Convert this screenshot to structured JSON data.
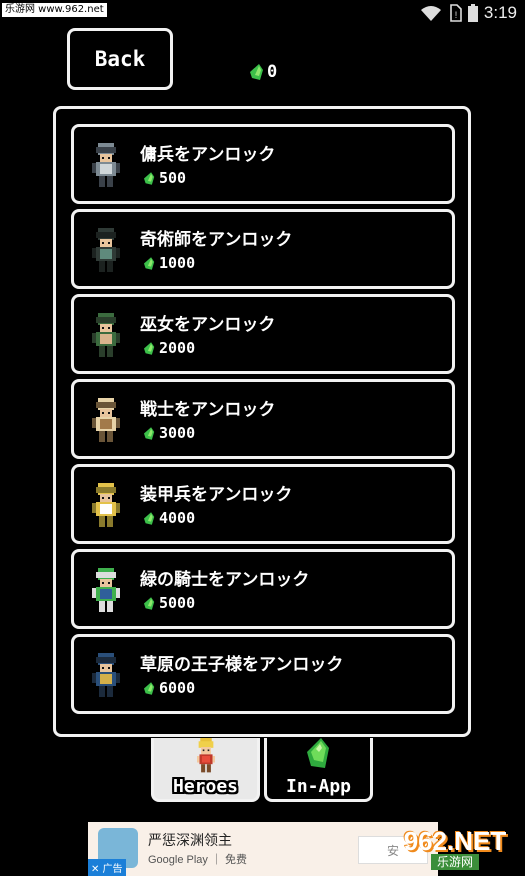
{
  "status_bar": {
    "watermark": "乐游网 www.962.net",
    "time": "3:19"
  },
  "header": {
    "back_label": "Back",
    "gem_count": "0"
  },
  "heroes": [
    {
      "name": "傭兵をアンロック",
      "cost": "500",
      "sprite": "mercenary-sprite",
      "colors": [
        "#7d8a93",
        "#cfd6d9",
        "#3a4149"
      ]
    },
    {
      "name": "奇術師をアンロック",
      "cost": "1000",
      "sprite": "magician-sprite",
      "colors": [
        "#2f3a36",
        "#5f8a7c",
        "#1c2220"
      ]
    },
    {
      "name": "巫女をアンロック",
      "cost": "2000",
      "sprite": "shrine-maiden-sprite",
      "colors": [
        "#3b6b3e",
        "#d9b48d",
        "#2a3e2b"
      ]
    },
    {
      "name": "戦士をアンロック",
      "cost": "3000",
      "sprite": "warrior-sprite",
      "colors": [
        "#e7d3a8",
        "#a27a4a",
        "#6a5538"
      ]
    },
    {
      "name": "装甲兵をアンロック",
      "cost": "4000",
      "sprite": "armored-soldier-sprite",
      "colors": [
        "#e3c24a",
        "#ffffff",
        "#8a7a2c"
      ]
    },
    {
      "name": "緑の騎士をアンロック",
      "cost": "5000",
      "sprite": "green-knight-sprite",
      "colors": [
        "#3fb04d",
        "#2f5f9a",
        "#dddddd"
      ]
    },
    {
      "name": "草原の王子様をアンロック",
      "cost": "6000",
      "sprite": "prairie-prince-sprite",
      "colors": [
        "#2a4f7a",
        "#d4b04a",
        "#1b2a3c"
      ]
    }
  ],
  "tabs": [
    {
      "label": "Heroes",
      "icon": "hero-icon",
      "active": true
    },
    {
      "label": "In-App",
      "icon": "gem-icon",
      "active": false
    }
  ],
  "ad": {
    "title": "严惩深渊领主",
    "subtitle": "Google Play ｜ 免费",
    "badge": "✕ 广告",
    "button": "安"
  },
  "watermark_bottom": {
    "big": "962.NET",
    "small": "乐游网"
  },
  "colors": {
    "background": "#000000",
    "border": "#f2f2f2",
    "gem": "#3cc04a",
    "tab_active": "#e9e9e9"
  }
}
